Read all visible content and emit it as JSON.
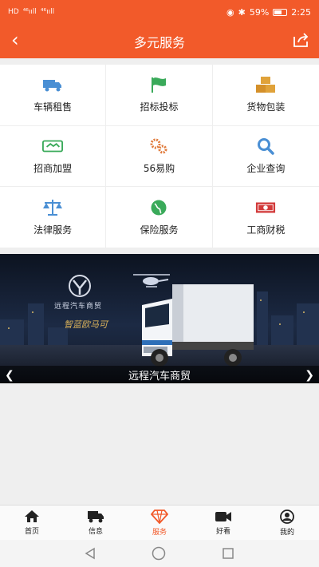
{
  "status_bar": {
    "carrier_left": "HD",
    "signal1": "⁴⁶ııll",
    "signal2": "⁴⁶ııll",
    "battery_text": "59%",
    "battery_level": 0.59,
    "time": "2:25"
  },
  "header": {
    "title": "多元服务",
    "back_icon": "chevron-left-icon",
    "share_icon": "share-icon"
  },
  "services": [
    {
      "label": "车辆租售",
      "icon": "truck-icon",
      "color": "#4a8fd4"
    },
    {
      "label": "招标投标",
      "icon": "flag-icon",
      "color": "#3aaa5a"
    },
    {
      "label": "货物包装",
      "icon": "boxes-icon",
      "color": "#e0a23a"
    },
    {
      "label": "招商加盟",
      "icon": "handshake-icon",
      "color": "#3aaa5a"
    },
    {
      "label": "56易购",
      "icon": "gears-icon",
      "color": "#e07a3a"
    },
    {
      "label": "企业查询",
      "icon": "search-icon",
      "color": "#4a8fd4"
    },
    {
      "label": "法律服务",
      "icon": "scales-icon",
      "color": "#4a8fd4"
    },
    {
      "label": "保险服务",
      "icon": "globe-icon",
      "color": "#3aaa5a"
    },
    {
      "label": "工商财税",
      "icon": "money-icon",
      "color": "#d23a3a"
    }
  ],
  "banner": {
    "caption": "远程汽车商贸",
    "logo_text": "远程汽车商贸",
    "slogan": "智蓝欧马可"
  },
  "tabs": [
    {
      "label": "首页",
      "icon": "home-icon"
    },
    {
      "label": "信息",
      "icon": "truck-icon"
    },
    {
      "label": "服务",
      "icon": "diamond-icon",
      "active": true
    },
    {
      "label": "好看",
      "icon": "video-icon"
    },
    {
      "label": "我的",
      "icon": "user-icon"
    }
  ],
  "colors": {
    "brand": "#f25a2a",
    "active_tab": "#f25a2a"
  }
}
